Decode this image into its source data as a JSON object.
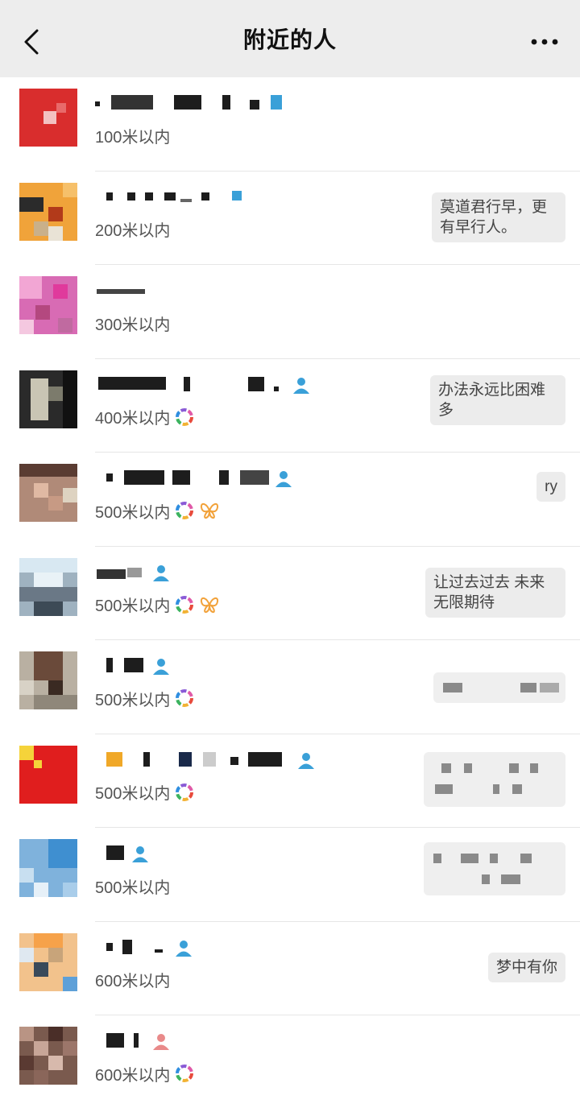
{
  "header": {
    "title": "附近的人",
    "back_icon": "chevron-left-icon",
    "more_icon": "more-dots-icon"
  },
  "colors": {
    "navbar_bg": "#ededed",
    "person_male": "#3aa0d8",
    "person_female": "#e98a8a",
    "bubble_bg": "#ececec"
  },
  "people": [
    {
      "distance": "100米以内",
      "status": ""
    },
    {
      "distance": "200米以内",
      "status": "莫道君行早，更有早行人。"
    },
    {
      "distance": "300米以内",
      "status": ""
    },
    {
      "distance": "400米以内",
      "status": "办法永远比困难多"
    },
    {
      "distance": "500米以内",
      "status": "ry"
    },
    {
      "distance": "500米以内",
      "status": "让过去过去 未来无限期待"
    },
    {
      "distance": "500米以内",
      "status": ""
    },
    {
      "distance": "500米以内",
      "status": ""
    },
    {
      "distance": "500米以内",
      "status": ""
    },
    {
      "distance": "600米以内",
      "status": "梦中有你"
    },
    {
      "distance": "600米以内",
      "status": ""
    }
  ]
}
